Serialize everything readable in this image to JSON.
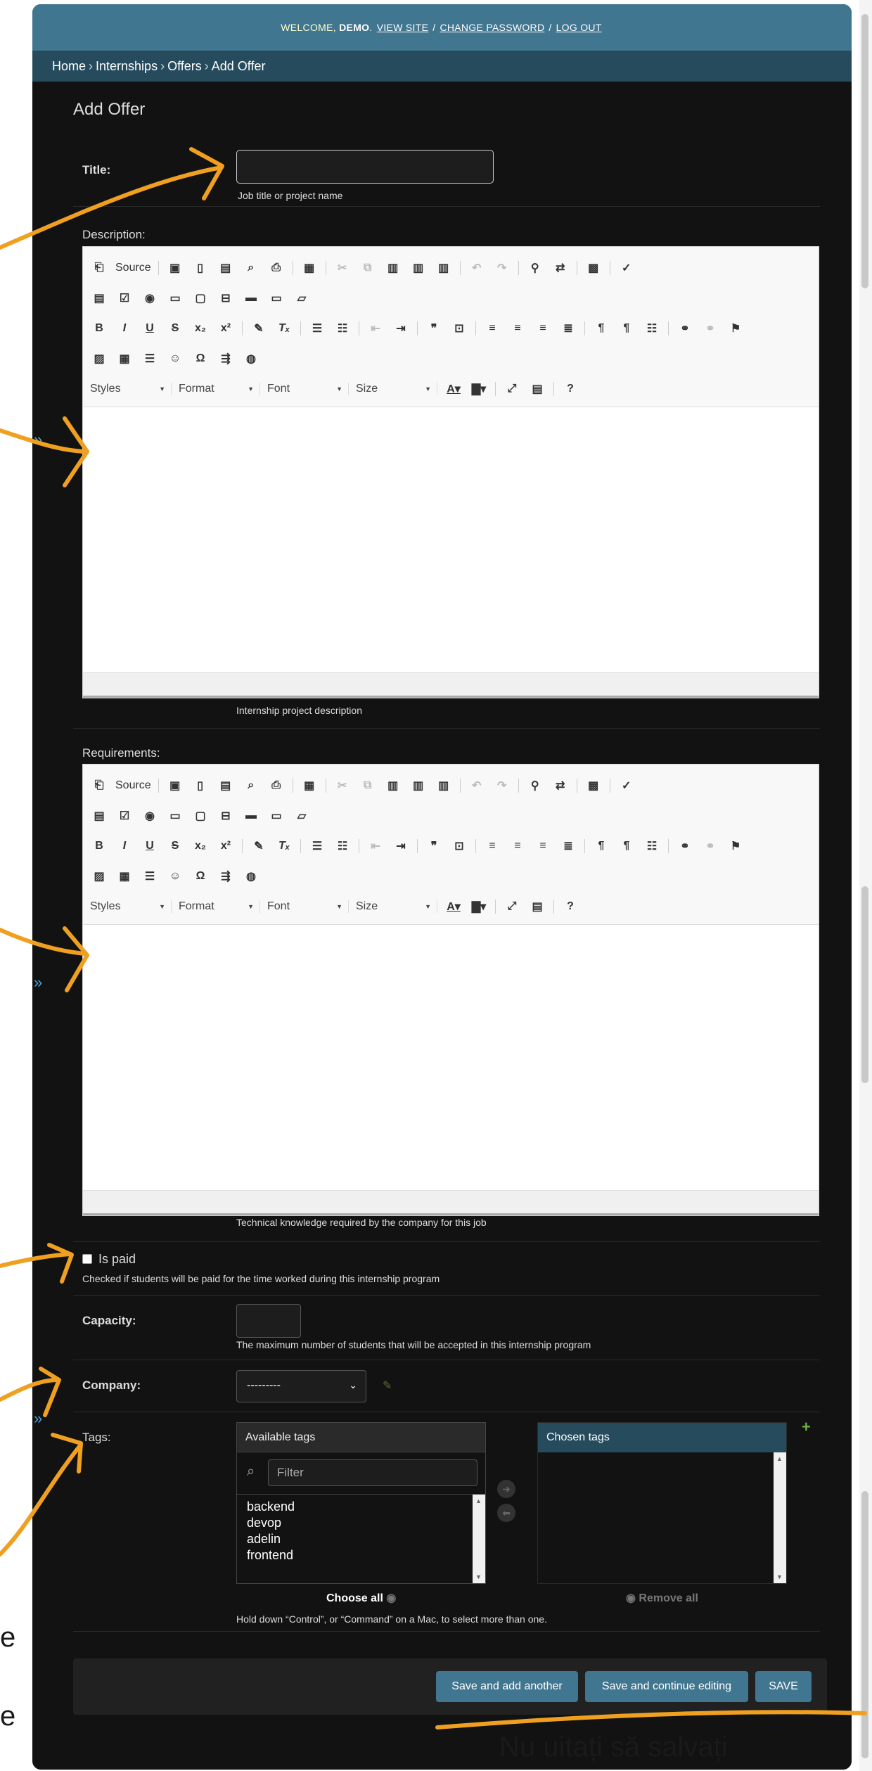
{
  "header": {
    "welcome": "WELCOME,",
    "user": "DEMO",
    "links": [
      "VIEW SITE",
      "CHANGE PASSWORD",
      "LOG OUT"
    ]
  },
  "breadcrumbs": [
    "Home",
    "Internships",
    "Offers",
    "Add Offer"
  ],
  "page_title": "Add Offer",
  "fields": {
    "title": {
      "label": "Title:",
      "value": "",
      "help": "Job title or project name"
    },
    "description": {
      "label": "Description:",
      "help": "Internship project description"
    },
    "requirements": {
      "label": "Requirements:",
      "help": "Technical knowledge required by the company for this job"
    },
    "is_paid": {
      "label": "Is paid",
      "checked": false,
      "help": "Checked if students will be paid for the time worked during this internship program"
    },
    "capacity": {
      "label": "Capacity:",
      "value": "",
      "help": "The maximum number of students that will be accepted in this internship program"
    },
    "company": {
      "label": "Company:",
      "selected": "---------"
    },
    "tags": {
      "label": "Tags:",
      "available_title": "Available tags",
      "filter_placeholder": "Filter",
      "available": [
        "backend",
        "devop",
        "adelin",
        "frontend"
      ],
      "chosen_title": "Chosen tags",
      "chosen": [],
      "choose_all": "Choose all",
      "remove_all": "Remove all",
      "help": "Hold down “Control”, or “Command” on a Mac, to select more than one."
    }
  },
  "editor_toolbar": {
    "source_label": "Source",
    "combos": [
      "Styles",
      "Format",
      "Font",
      "Size"
    ]
  },
  "buttons": {
    "save_add_another": "Save and add another",
    "save_continue": "Save and continue editing",
    "save": "SAVE"
  },
  "annotation": {
    "caption": "Nu uitați să salvați",
    "edge_letter": "e",
    "color": "#f0a020"
  }
}
